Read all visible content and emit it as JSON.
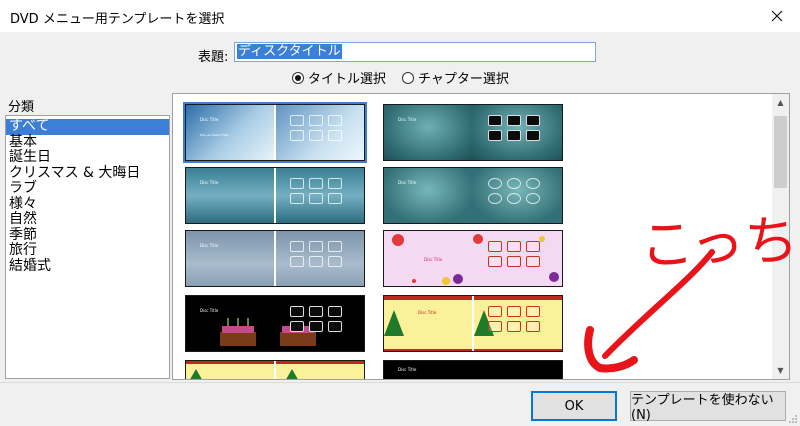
{
  "window": {
    "title": "DVD メニュー用テンプレートを選択"
  },
  "form": {
    "label": "表題:",
    "value": "ディスクタイトル",
    "options": [
      {
        "label": "タイトル選択",
        "selected": true
      },
      {
        "label": "チャプター選択",
        "selected": false
      }
    ]
  },
  "categories": {
    "heading": "分類",
    "items": [
      "すべて",
      "基本",
      "誕生日",
      "クリスマス & 大晦日",
      "ラブ",
      "様々",
      "自然",
      "季節",
      "旅行",
      "結婚式"
    ],
    "selected_index": 0
  },
  "thumbnails": {
    "caption_title": "Disc Title",
    "caption_sub": "Play All\nSelect Title",
    "items": [
      {
        "theme": "blue-light",
        "selected": true
      },
      {
        "theme": "teal-dark"
      },
      {
        "theme": "teal-stripes"
      },
      {
        "theme": "teal-ovals"
      },
      {
        "theme": "grey-blue"
      },
      {
        "theme": "pink-hearts"
      },
      {
        "theme": "birthday-cake"
      },
      {
        "theme": "christmas"
      },
      {
        "theme": "christmas-yellow"
      },
      {
        "theme": "black-partial"
      }
    ]
  },
  "buttons": {
    "ok": "OK",
    "no_template": "テンプレートを使わない(N)"
  },
  "annotation": {
    "text": "こっち",
    "color": "#e8141a"
  }
}
